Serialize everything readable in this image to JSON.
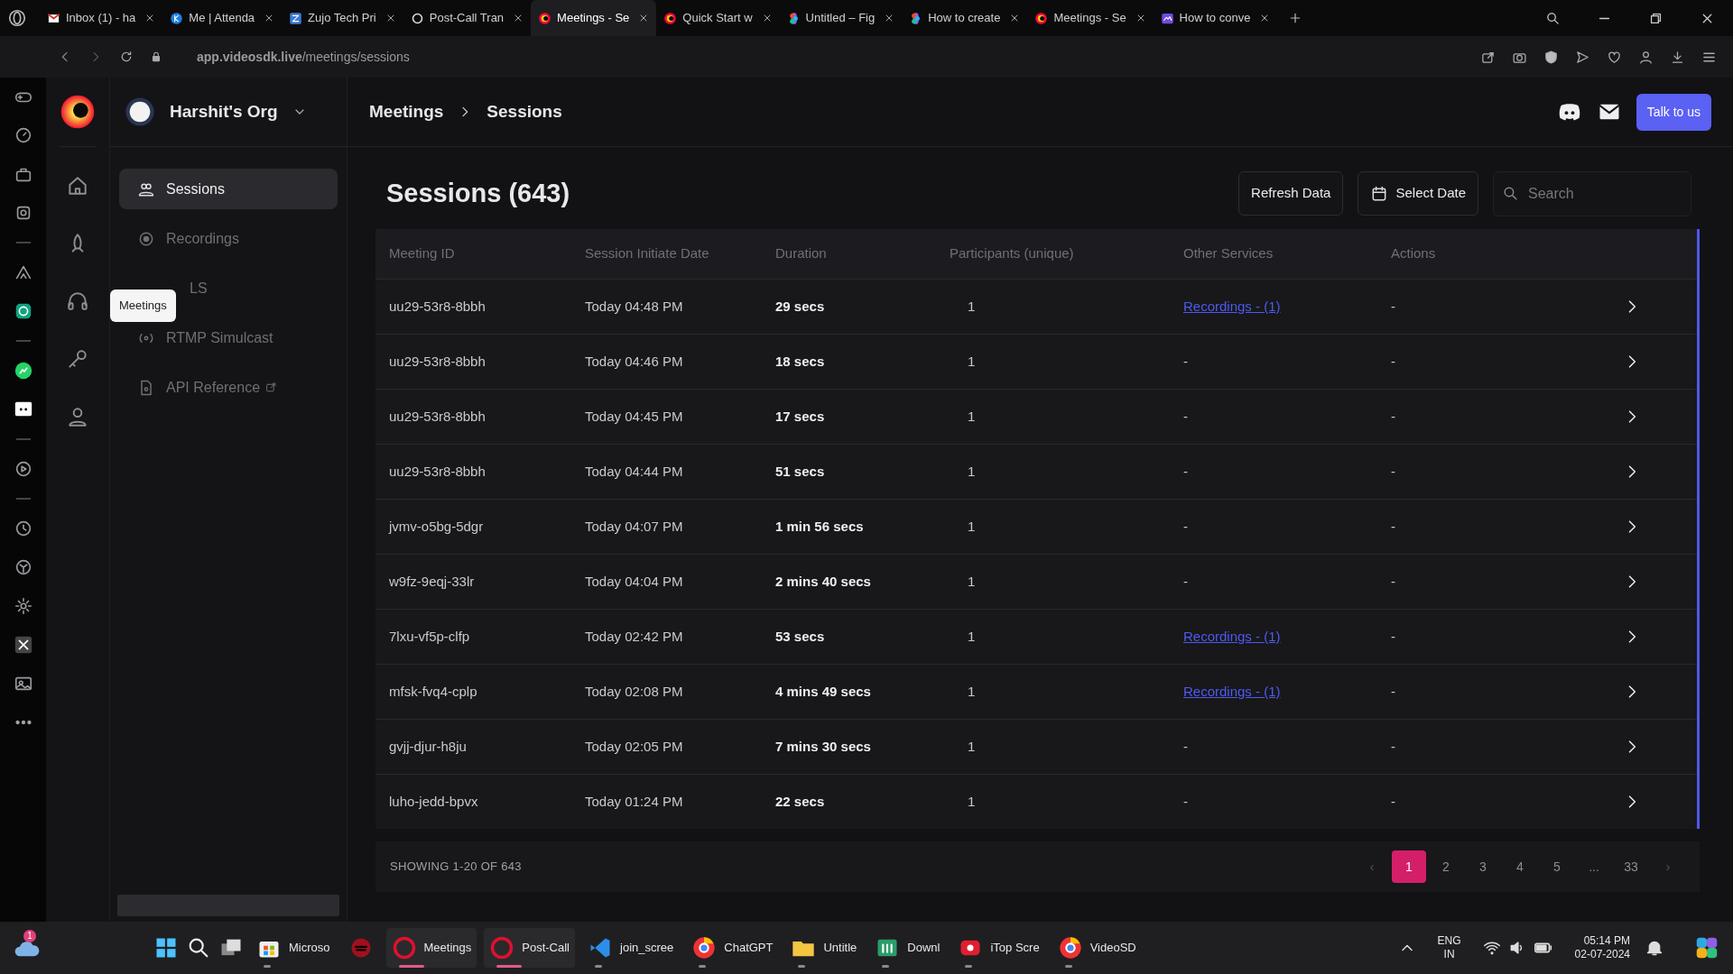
{
  "browser": {
    "tabs": [
      {
        "title": "Inbox (1) - ha",
        "selected": false
      },
      {
        "title": "Me | Attenda",
        "selected": false
      },
      {
        "title": "Zujo Tech Pri",
        "selected": false
      },
      {
        "title": "Post-Call Tran",
        "selected": false
      },
      {
        "title": "Meetings - Se",
        "selected": true
      },
      {
        "title": "Quick Start w",
        "selected": false
      },
      {
        "title": "Untitled – Fig",
        "selected": false
      },
      {
        "title": "How to create",
        "selected": false
      },
      {
        "title": "Meetings - Se",
        "selected": false
      },
      {
        "title": "How to conve",
        "selected": false
      }
    ],
    "url": "**app.videosdk.live**/meetings/sessions"
  },
  "app": {
    "org_name": "Harshit's Org",
    "nav": [
      {
        "label": "Sessions",
        "selected": true
      },
      {
        "label": "Recordings",
        "selected": false
      },
      {
        "label": "LS",
        "selected": false
      },
      {
        "label": "RTMP Simulcast",
        "selected": false
      },
      {
        "label": "API Reference",
        "selected": false
      }
    ],
    "tooltip": "Meetings",
    "breadcrumb": [
      "Meetings",
      "Sessions"
    ],
    "talk_button": "Talk to us",
    "page_title": "Sessions (643)",
    "refresh_button": "Refresh Data",
    "date_button": "Select Date",
    "search_placeholder": "Search",
    "table": {
      "columns": [
        "Meeting ID",
        "Session Initiate Date",
        "Duration",
        "Participants (unique)",
        "Other Services",
        "Actions"
      ],
      "rows": [
        {
          "meeting_id": "uu29-53r8-8bbh",
          "date": "Today 04:48 PM",
          "duration": "29 secs",
          "participants": "1",
          "other_services": "Recordings - (1)",
          "kind": "link",
          "actions": "-"
        },
        {
          "meeting_id": "uu29-53r8-8bbh",
          "date": "Today 04:46 PM",
          "duration": "18 secs",
          "participants": "1",
          "other_services": "-",
          "kind": "text",
          "actions": "-"
        },
        {
          "meeting_id": "uu29-53r8-8bbh",
          "date": "Today 04:45 PM",
          "duration": "17 secs",
          "participants": "1",
          "other_services": "-",
          "kind": "text",
          "actions": "-"
        },
        {
          "meeting_id": "uu29-53r8-8bbh",
          "date": "Today 04:44 PM",
          "duration": "51 secs",
          "participants": "1",
          "other_services": "-",
          "kind": "text",
          "actions": "-"
        },
        {
          "meeting_id": "jvmv-o5bg-5dgr",
          "date": "Today 04:07 PM",
          "duration": "1 min 56 secs",
          "participants": "1",
          "other_services": "-",
          "kind": "text",
          "actions": "-"
        },
        {
          "meeting_id": "w9fz-9eqj-33lr",
          "date": "Today 04:04 PM",
          "duration": "2 mins 40 secs",
          "participants": "1",
          "other_services": "-",
          "kind": "text",
          "actions": "-"
        },
        {
          "meeting_id": "7lxu-vf5p-clfp",
          "date": "Today 02:42 PM",
          "duration": "53 secs",
          "participants": "1",
          "other_services": "Recordings - (1)",
          "kind": "link",
          "actions": "-"
        },
        {
          "meeting_id": "mfsk-fvq4-cplp",
          "date": "Today 02:08 PM",
          "duration": "4 mins 49 secs",
          "participants": "1",
          "other_services": "Recordings - (1)",
          "kind": "link",
          "actions": "-"
        },
        {
          "meeting_id": "gvjj-djur-h8ju",
          "date": "Today 02:05 PM",
          "duration": "7 mins 30 secs",
          "participants": "1",
          "other_services": "-",
          "kind": "text",
          "actions": "-"
        },
        {
          "meeting_id": "luho-jedd-bpvx",
          "date": "Today 01:24 PM",
          "duration": "22 secs",
          "participants": "1",
          "other_services": "-",
          "kind": "text",
          "actions": "-"
        }
      ]
    },
    "footer": {
      "showing": "SHOWING 1-20 OF 643",
      "pages": [
        {
          "label": "‹",
          "kind": "arrow",
          "selected": false
        },
        {
          "label": "1",
          "kind": "page",
          "selected": true
        },
        {
          "label": "2",
          "kind": "page",
          "selected": false
        },
        {
          "label": "3",
          "kind": "page",
          "selected": false
        },
        {
          "label": "4",
          "kind": "page",
          "selected": false
        },
        {
          "label": "5",
          "kind": "page",
          "selected": false
        },
        {
          "label": "...",
          "kind": "gap",
          "selected": false
        },
        {
          "label": "33",
          "kind": "page",
          "selected": false
        },
        {
          "label": "›",
          "kind": "arrow",
          "selected": false
        }
      ]
    }
  },
  "taskbar": {
    "weather_badge": "1",
    "apps": [
      {
        "label": "Microso",
        "open": true,
        "focused": false
      },
      {
        "open": false,
        "focused": false
      },
      {
        "label": "Meetings",
        "open": true,
        "focused": true
      },
      {
        "label": "Post-Call",
        "open": true,
        "focused": true
      },
      {
        "label": "join_scree",
        "open": true,
        "focused": false
      },
      {
        "label": "ChatGPT",
        "open": true,
        "focused": false
      },
      {
        "label": "Untitle",
        "open": true,
        "focused": false
      },
      {
        "label": "Downl",
        "open": true,
        "focused": false
      },
      {
        "label": "iTop Scre",
        "open": true,
        "focused": false
      },
      {
        "label": "VideoSD",
        "open": true,
        "focused": false
      }
    ],
    "language": "ENG",
    "region": "IN",
    "time": "05:14 PM",
    "date": "02-07-2024"
  }
}
